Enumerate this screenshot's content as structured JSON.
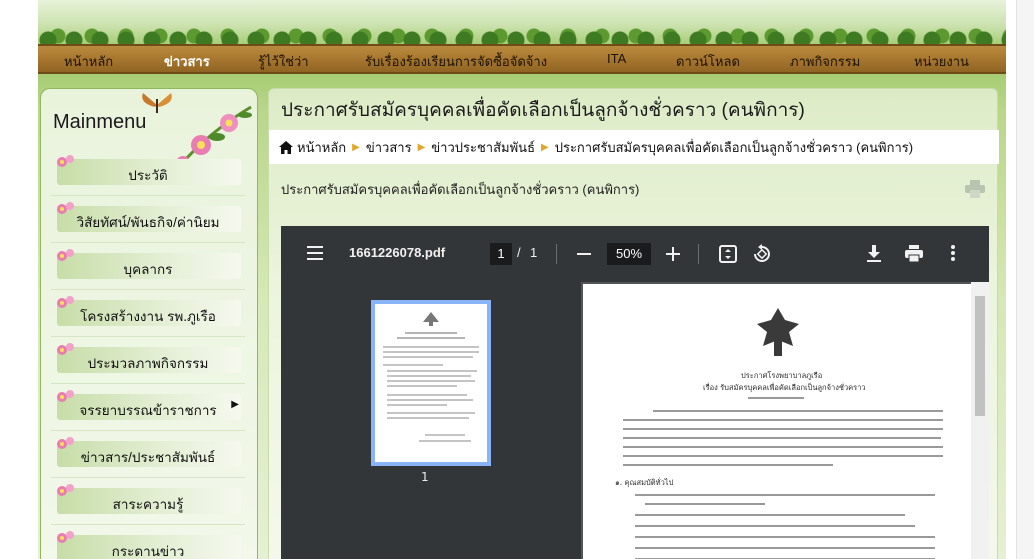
{
  "nav": {
    "items": [
      {
        "label": "หน้าหลัก",
        "active": false
      },
      {
        "label": "ข่าวสาร",
        "active": true
      },
      {
        "label": "รู้ไว้ใช่ว่า",
        "active": false
      },
      {
        "label": "รับเรื่องร้องเรียนการจัดซื้อจัดจ้าง",
        "active": false
      },
      {
        "label": "ITA",
        "active": false
      },
      {
        "label": "ดาวน์โหลด",
        "active": false
      },
      {
        "label": "ภาพกิจกรรม",
        "active": false
      },
      {
        "label": "หน่วยงาน",
        "active": false
      }
    ]
  },
  "sidebar": {
    "title": "Mainmenu",
    "items": [
      {
        "label": "ประวัติ"
      },
      {
        "label": "วิสัยทัศน์/พันธกิจ/ค่านิยม"
      },
      {
        "label": "บุคลากร"
      },
      {
        "label": "โครงสร้างงาน รพ.ภูเรือ"
      },
      {
        "label": "ประมวลภาพกิจกรรม"
      },
      {
        "label": "จรรยาบรรณข้าราชการ",
        "submenu": true
      },
      {
        "label": "ข่าวสาร/ประชาสัมพันธ์"
      },
      {
        "label": "สาระความรู้"
      },
      {
        "label": "กระดานข่าว"
      }
    ]
  },
  "main": {
    "title": "ประกาศรับสมัครบุคคลเพื่อคัดเลือกเป็นลูกจ้างชั่วคราว (คนพิการ)",
    "breadcrumb": [
      "หน้าหลัก",
      "ข่าวสาร",
      "ข่าวประชาสัมพันธ์",
      "ประกาศรับสมัครบุคคลเพื่อคัดเลือกเป็นลูกจ้างชั่วคราว (คนพิการ)"
    ],
    "subtitle": "ประกาศรับสมัครบุคคลเพื่อคัดเลือกเป็นลูกจ้างชั่วคราว (คนพิการ)"
  },
  "pdf": {
    "filename": "1661226078.pdf",
    "current_page": "1",
    "page_sep": "/",
    "total_pages": "1",
    "zoom": "50%",
    "thumb_label": "1",
    "doc": {
      "org": "ประกาศโรงพยาบาลภูเรือ",
      "subject": "เรื่อง  รับสมัครบุคคลเพื่อคัดเลือกเป็นลูกจ้างชั่วคราว",
      "section1": "๑. คุณสมบัติทั่วไป"
    }
  },
  "colors": {
    "nav_bg": "#a8772f",
    "pdf_toolbar": "#323639",
    "thumb_highlight": "#8ab4f8",
    "breadcrumb_sep": "#e2a72a"
  }
}
